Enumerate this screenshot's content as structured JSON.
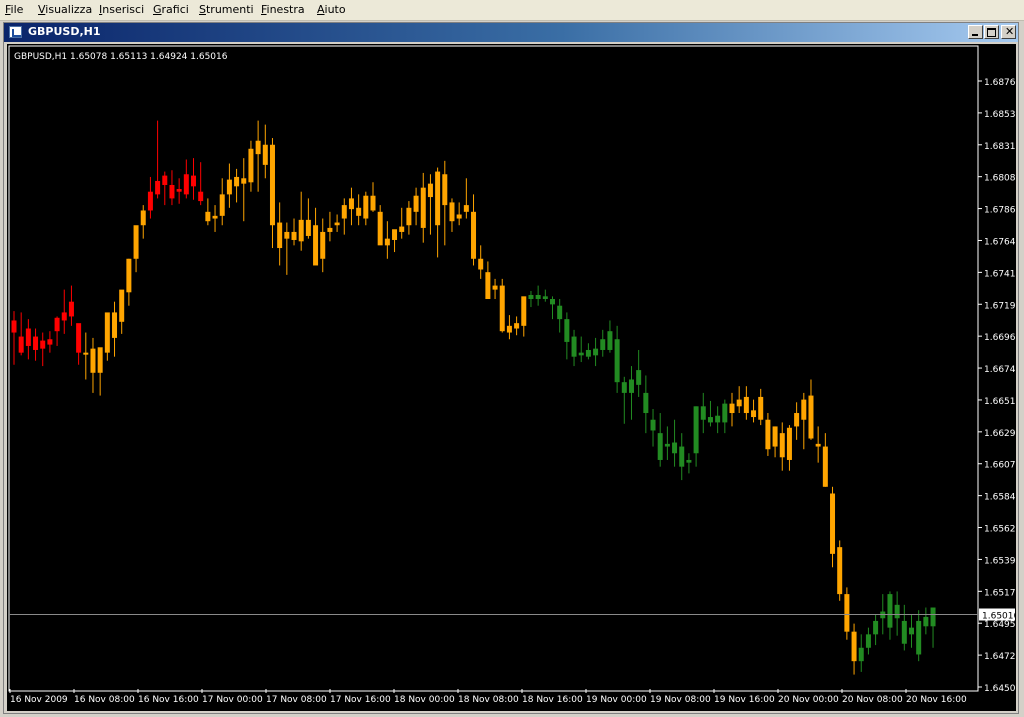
{
  "menu": [
    {
      "label": "File",
      "u": "F",
      "rest": "ile"
    },
    {
      "label": "Visualizza",
      "u": "V",
      "rest": "isualizza"
    },
    {
      "label": "Inserisci",
      "u": "I",
      "rest": "nserisci"
    },
    {
      "label": "Grafici",
      "u": "G",
      "rest": "rafici"
    },
    {
      "label": "Strumenti",
      "u": "S",
      "rest": "trumenti"
    },
    {
      "label": "Finestra",
      "u": "F",
      "rest": "inestra"
    },
    {
      "label": "Aiuto",
      "u": "A",
      "rest": "iuto"
    }
  ],
  "window": {
    "title": "GBPUSD,H1",
    "icon": "chart-window-icon"
  },
  "chart_data": {
    "type": "candlestick",
    "symbol": "GBPUSD,H1",
    "info_line": "GBPUSD,H1  1.65078 1.65113 1.64924 1.65016",
    "ylim": [
      1.645,
      1.6898
    ],
    "y_ticks": [
      "1.68760",
      "1.68535",
      "1.68310",
      "1.68085",
      "1.67860",
      "1.67640",
      "1.67415",
      "1.67190",
      "1.66965",
      "1.66740",
      "1.66515",
      "1.66295",
      "1.66070",
      "1.65845",
      "1.65620",
      "1.65395",
      "1.65170",
      "1.64950",
      "1.64725",
      "1.64500"
    ],
    "x_ticks": [
      "16 Nov 2009",
      "16 Nov 08:00",
      "16 Nov 16:00",
      "17 Nov 00:00",
      "17 Nov 08:00",
      "17 Nov 16:00",
      "18 Nov 00:00",
      "18 Nov 08:00",
      "18 Nov 16:00",
      "19 Nov 00:00",
      "19 Nov 08:00",
      "19 Nov 16:00",
      "20 Nov 00:00",
      "20 Nov 08:00",
      "20 Nov 16:00"
    ],
    "current_price": "1.65016",
    "grid": false,
    "colors": {
      "background": "#000000",
      "text": "#ffffff",
      "red": "#ff0000",
      "orange": "#ffa500",
      "green": "#228b22",
      "price_line": "#8a8a8a"
    },
    "candles": [
      [
        "r",
        1.6715,
        1.6731,
        1.6691,
        1.6724
      ],
      [
        "r",
        1.6712,
        1.673,
        1.6698,
        1.67
      ],
      [
        "r",
        1.6718,
        1.6725,
        1.6695,
        1.6705
      ],
      [
        "r",
        1.6712,
        1.6718,
        1.6694,
        1.6702
      ],
      [
        "r",
        1.6703,
        1.6715,
        1.669,
        1.6709
      ],
      [
        "r",
        1.671,
        1.6716,
        1.67,
        1.6706
      ],
      [
        "r",
        1.6716,
        1.6727,
        1.6705,
        1.6726
      ],
      [
        "r",
        1.673,
        1.6747,
        1.6714,
        1.6724
      ],
      [
        "r",
        1.6738,
        1.675,
        1.672,
        1.6727
      ],
      [
        "r",
        1.67,
        1.6714,
        1.6691,
        1.6722
      ],
      [
        "o",
        1.67,
        1.6715,
        1.668,
        1.67
      ],
      [
        "o",
        1.6703,
        1.6711,
        1.667,
        1.6685
      ],
      [
        "o",
        1.6685,
        1.67,
        1.6668,
        1.6704
      ],
      [
        "o",
        1.67,
        1.6718,
        1.6694,
        1.673
      ],
      [
        "o",
        1.6711,
        1.6738,
        1.6697,
        1.673
      ],
      [
        "o",
        1.6723,
        1.6742,
        1.6714,
        1.6747
      ],
      [
        "o",
        1.6745,
        1.677,
        1.6735,
        1.677
      ],
      [
        "o",
        1.677,
        1.679,
        1.676,
        1.6795
      ],
      [
        "o",
        1.6795,
        1.681,
        1.6785,
        1.6806
      ],
      [
        "r",
        1.682,
        1.6831,
        1.68,
        1.6806
      ],
      [
        "r",
        1.6828,
        1.6873,
        1.6815,
        1.6818
      ],
      [
        "r",
        1.6825,
        1.6835,
        1.681,
        1.6832
      ],
      [
        "r",
        1.6815,
        1.6836,
        1.681,
        1.6825
      ],
      [
        "r",
        1.682,
        1.683,
        1.6811,
        1.6822
      ],
      [
        "r",
        1.6833,
        1.6844,
        1.6815,
        1.6818
      ],
      [
        "r",
        1.6824,
        1.6845,
        1.6814,
        1.6832
      ],
      [
        "r",
        1.682,
        1.6842,
        1.681,
        1.6813
      ],
      [
        "o",
        1.6805,
        1.6815,
        1.6795,
        1.6798
      ],
      [
        "o",
        1.68,
        1.681,
        1.679,
        1.6802
      ],
      [
        "o",
        1.6802,
        1.683,
        1.6795,
        1.6818
      ],
      [
        "o",
        1.6818,
        1.6841,
        1.6808,
        1.6829
      ],
      [
        "o",
        1.6824,
        1.6837,
        1.6812,
        1.6831
      ],
      [
        "o",
        1.683,
        1.6845,
        1.6798,
        1.6826
      ],
      [
        "o",
        1.6827,
        1.6858,
        1.682,
        1.6852
      ],
      [
        "o",
        1.6858,
        1.6873,
        1.682,
        1.6848
      ],
      [
        "o",
        1.6855,
        1.687,
        1.683,
        1.684
      ],
      [
        "o",
        1.6795,
        1.686,
        1.6778,
        1.6855
      ],
      [
        "o",
        1.6797,
        1.6812,
        1.6765,
        1.6778
      ],
      [
        "o",
        1.6785,
        1.6797,
        1.6758,
        1.679
      ],
      [
        "o",
        1.679,
        1.68,
        1.678,
        1.6784
      ],
      [
        "o",
        1.6783,
        1.682,
        1.6776,
        1.6799
      ],
      [
        "o",
        1.6799,
        1.6815,
        1.6785,
        1.6787
      ],
      [
        "o",
        1.6795,
        1.6808,
        1.677,
        1.6765
      ],
      [
        "o",
        1.679,
        1.68,
        1.676,
        1.677
      ],
      [
        "o",
        1.679,
        1.6805,
        1.6783,
        1.6793
      ],
      [
        "o",
        1.6797,
        1.6803,
        1.679,
        1.6795
      ],
      [
        "o",
        1.68,
        1.6815,
        1.6788,
        1.681
      ],
      [
        "o",
        1.6807,
        1.6823,
        1.6795,
        1.6815
      ],
      [
        "o",
        1.6808,
        1.6818,
        1.6795,
        1.6802
      ],
      [
        "o",
        1.68,
        1.682,
        1.6795,
        1.6817
      ],
      [
        "o",
        1.6817,
        1.6827,
        1.6805,
        1.6806
      ],
      [
        "o",
        1.6805,
        1.681,
        1.6785,
        1.678
      ],
      [
        "o",
        1.678,
        1.6798,
        1.677,
        1.6785
      ],
      [
        "o",
        1.6784,
        1.679,
        1.6775,
        1.6792
      ],
      [
        "o",
        1.679,
        1.6808,
        1.6785,
        1.6794
      ],
      [
        "o",
        1.6795,
        1.6813,
        1.6788,
        1.6808
      ],
      [
        "o",
        1.6805,
        1.6823,
        1.6795,
        1.6817
      ],
      [
        "o",
        1.6823,
        1.6834,
        1.6782,
        1.6793
      ],
      [
        "o",
        1.6816,
        1.6833,
        1.6788,
        1.6826
      ],
      [
        "o",
        1.6795,
        1.6838,
        1.6771,
        1.6835
      ],
      [
        "o",
        1.6833,
        1.6843,
        1.678,
        1.681
      ],
      [
        "o",
        1.6798,
        1.6815,
        1.679,
        1.6812
      ],
      [
        "o",
        1.6803,
        1.6812,
        1.6795,
        1.68
      ],
      [
        "o",
        1.681,
        1.683,
        1.68,
        1.6805
      ],
      [
        "o",
        1.6805,
        1.6818,
        1.6765,
        1.677
      ],
      [
        "o",
        1.677,
        1.678,
        1.6755,
        1.6762
      ],
      [
        "o",
        1.676,
        1.6768,
        1.674,
        1.674
      ],
      [
        "o",
        1.675,
        1.6755,
        1.674,
        1.6747
      ],
      [
        "o",
        1.675,
        1.6755,
        1.6715,
        1.6716
      ],
      [
        "o",
        1.672,
        1.6728,
        1.671,
        1.6715
      ],
      [
        "o",
        1.6718,
        1.6727,
        1.6713,
        1.6722
      ],
      [
        "o",
        1.672,
        1.674,
        1.6712,
        1.6742
      ],
      [
        "g",
        1.674,
        1.6746,
        1.6734,
        1.6743
      ],
      [
        "g",
        1.6743,
        1.675,
        1.6735,
        1.674
      ],
      [
        "g",
        1.6742,
        1.6747,
        1.6738,
        1.674
      ],
      [
        "g",
        1.6736,
        1.6742,
        1.6725,
        1.674
      ],
      [
        "g",
        1.6735,
        1.674,
        1.6715,
        1.6725
      ],
      [
        "g",
        1.6725,
        1.673,
        1.6695,
        1.6708
      ],
      [
        "g",
        1.6712,
        1.6717,
        1.669,
        1.6697
      ],
      [
        "g",
        1.6698,
        1.6712,
        1.6693,
        1.67
      ],
      [
        "g",
        1.6702,
        1.6707,
        1.6695,
        1.6697
      ],
      [
        "g",
        1.6703,
        1.6711,
        1.669,
        1.6698
      ],
      [
        "g",
        1.6702,
        1.6717,
        1.6697,
        1.671
      ],
      [
        "g",
        1.6716,
        1.6724,
        1.67,
        1.6702
      ],
      [
        "g",
        1.671,
        1.672,
        1.667,
        1.6678
      ],
      [
        "g",
        1.6678,
        1.6682,
        1.6647,
        1.667
      ],
      [
        "g",
        1.668,
        1.669,
        1.665,
        1.667
      ],
      [
        "g",
        1.6687,
        1.6702,
        1.6667,
        1.6676
      ],
      [
        "g",
        1.667,
        1.6683,
        1.664,
        1.6655
      ],
      [
        "g",
        1.665,
        1.6658,
        1.663,
        1.6642
      ],
      [
        "g",
        1.664,
        1.6655,
        1.6615,
        1.662
      ],
      [
        "g",
        1.6632,
        1.6645,
        1.662,
        1.663
      ],
      [
        "g",
        1.6633,
        1.665,
        1.6615,
        1.6625
      ],
      [
        "g",
        1.663,
        1.664,
        1.6605,
        1.6615
      ],
      [
        "g",
        1.6618,
        1.6625,
        1.661,
        1.662
      ],
      [
        "g",
        1.6625,
        1.666,
        1.6615,
        1.666
      ],
      [
        "g",
        1.665,
        1.667,
        1.664,
        1.666
      ],
      [
        "g",
        1.6652,
        1.6664,
        1.6645,
        1.6648
      ],
      [
        "g",
        1.6648,
        1.666,
        1.664,
        1.6653
      ],
      [
        "g",
        1.6648,
        1.6665,
        1.664,
        1.6662
      ],
      [
        "o",
        1.6662,
        1.667,
        1.6645,
        1.6655
      ],
      [
        "o",
        1.6665,
        1.6675,
        1.6655,
        1.666
      ],
      [
        "o",
        1.6667,
        1.6675,
        1.665,
        1.6655
      ],
      [
        "o",
        1.6657,
        1.6665,
        1.6648,
        1.6652
      ],
      [
        "o",
        1.6667,
        1.6673,
        1.6646,
        1.665
      ],
      [
        "o",
        1.665,
        1.6655,
        1.6623,
        1.6628
      ],
      [
        "o",
        1.663,
        1.6645,
        1.6622,
        1.6645
      ],
      [
        "o",
        1.6622,
        1.6648,
        1.6612,
        1.664
      ],
      [
        "o",
        1.662,
        1.6646,
        1.6612,
        1.6644
      ],
      [
        "o",
        1.6645,
        1.6663,
        1.6635,
        1.6655
      ],
      [
        "o",
        1.665,
        1.667,
        1.6628,
        1.6665
      ],
      [
        "o",
        1.6668,
        1.668,
        1.6635,
        1.6636
      ],
      [
        "o",
        1.6632,
        1.6645,
        1.6618,
        1.663
      ],
      [
        "o",
        1.663,
        1.664,
        1.66,
        1.66
      ],
      [
        "o",
        1.6595,
        1.66,
        1.654,
        1.655
      ],
      [
        "o",
        1.6555,
        1.656,
        1.6515,
        1.652
      ],
      [
        "o",
        1.652,
        1.6525,
        1.6486,
        1.6492
      ],
      [
        "o",
        1.6492,
        1.6498,
        1.646,
        1.647
      ],
      [
        "g",
        1.647,
        1.649,
        1.6462,
        1.648
      ],
      [
        "g",
        1.648,
        1.6495,
        1.6475,
        1.649
      ],
      [
        "g",
        1.649,
        1.6505,
        1.6482,
        1.65
      ],
      [
        "g",
        1.6502,
        1.652,
        1.649,
        1.6507
      ],
      [
        "g",
        1.6495,
        1.6522,
        1.6486,
        1.652
      ],
      [
        "g",
        1.6512,
        1.6522,
        1.6489,
        1.6502
      ],
      [
        "g",
        1.65,
        1.6512,
        1.6478,
        1.6483
      ],
      [
        "g",
        1.6495,
        1.6505,
        1.648,
        1.649
      ],
      [
        "g",
        1.65,
        1.6508,
        1.647,
        1.6475
      ],
      [
        "g",
        1.6503,
        1.651,
        1.649,
        1.6496
      ],
      [
        "g",
        1.6496,
        1.651,
        1.648,
        1.651
      ]
    ]
  }
}
